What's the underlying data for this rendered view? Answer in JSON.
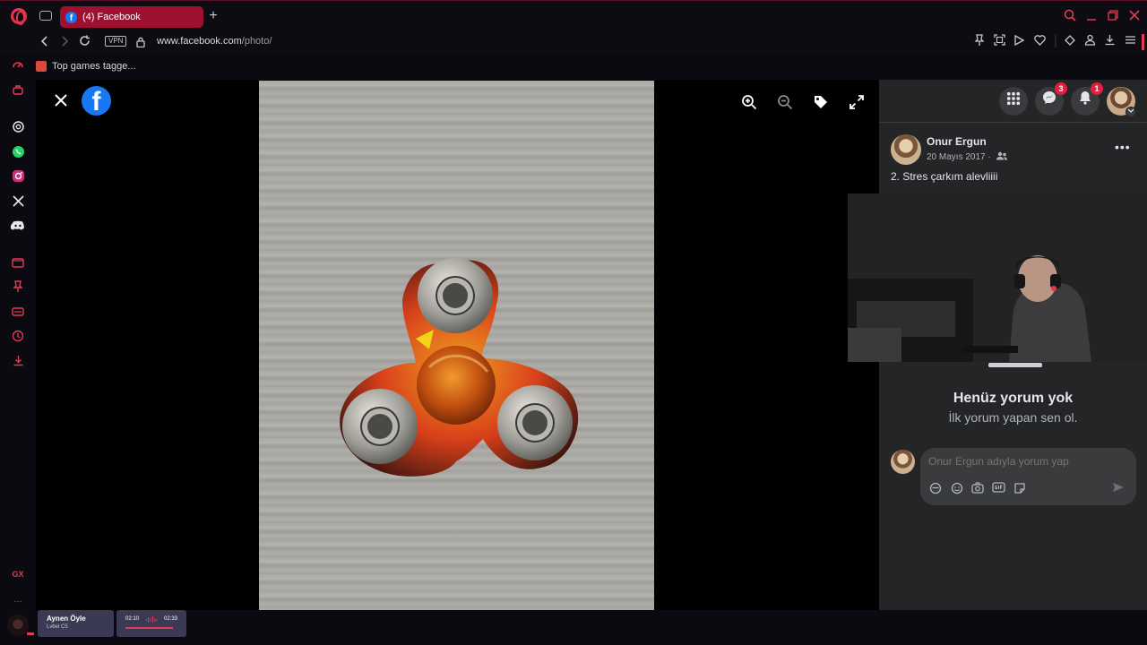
{
  "browser": {
    "tab_title": "(4) Facebook",
    "new_tab_label": "+",
    "vpn_label": "VPN",
    "url_host": "www.facebook.com",
    "url_path": "/photo/",
    "bookmark_label": "Top games tagge...",
    "gx_label": "GX",
    "more_label": "...",
    "accent_color": "#e23a55"
  },
  "facebook": {
    "messenger_badge": "3",
    "notifications_badge": "1",
    "post": {
      "author": "Onur Ergun",
      "date": "20 Mayıs 2017 ·",
      "caption": "2. Stres çarkım alevliiii"
    },
    "comments": {
      "empty_title": "Henüz yorum yok",
      "empty_subtitle": "İlk yorum yapan sen ol.",
      "input_placeholder": "Onur Ergun adıyla yorum yap"
    }
  },
  "player": {
    "title": "Aynen Öyle",
    "artist": "Lvbel C5",
    "time_current": "02:10",
    "time_total": "02:33"
  }
}
